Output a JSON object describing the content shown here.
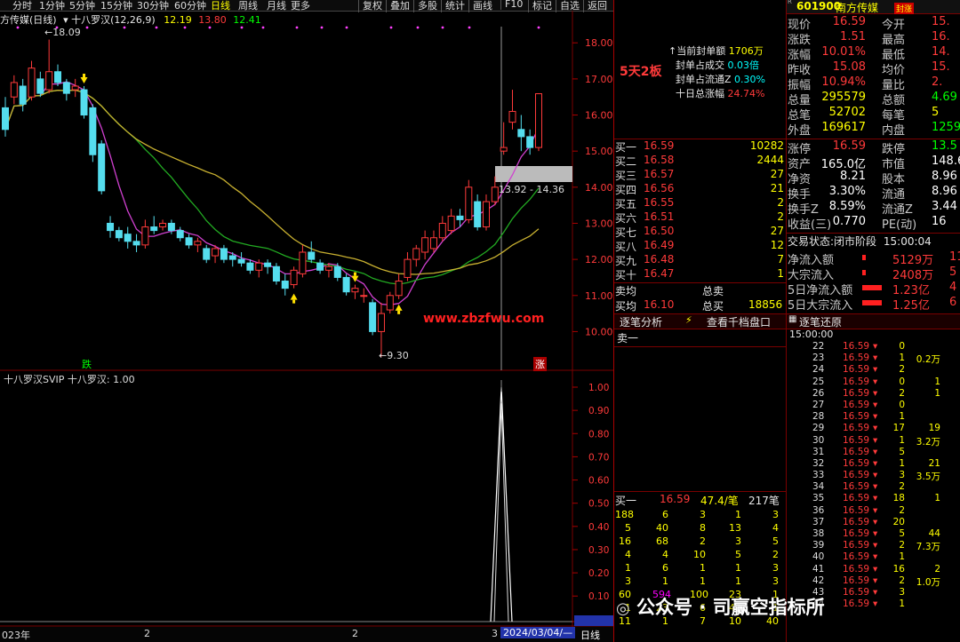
{
  "toolbar": {
    "periods": [
      "分时",
      "1分钟",
      "5分钟",
      "15分钟",
      "30分钟",
      "60分钟",
      "日线",
      "周线",
      "月线",
      "更多"
    ],
    "active_period": "日线",
    "tools": [
      "复权",
      "叠加",
      "多股",
      "统计",
      "画线",
      "F10",
      "标记",
      "自选",
      "返回"
    ]
  },
  "chart": {
    "title_left": "方传媒(日线)",
    "indicator_name": "十八罗汉(12,26,9)",
    "indicator_values": [
      "12.19",
      "13.80",
      "12.41"
    ],
    "high_label": "18.09",
    "low_label": "9.30",
    "range_label": "13.92 - 14.36",
    "y_ticks": [
      "18.00",
      "17.00",
      "16.00",
      "15.00",
      "14.00",
      "13.00",
      "12.00",
      "11.00",
      "10.00"
    ],
    "die_label": "跌",
    "zhang_label": "涨",
    "watermark": "www.zbzfwu.com",
    "lower_title": "十八罗汉SVIP  十八罗汉: 1.00",
    "lower_y_ticks": [
      "1.00",
      "0.90",
      "0.80",
      "0.70",
      "0.60",
      "0.50",
      "0.40",
      "0.30",
      "0.20",
      "0.10",
      "-0.01"
    ],
    "bottom_labels": [
      "023年",
      "2",
      "2",
      "3",
      "2024/03/04/—"
    ],
    "bottom_right": "日线",
    "candles": [
      {
        "o": 16.2,
        "c": 15.6,
        "h": 16.5,
        "l": 15.4
      },
      {
        "o": 16.5,
        "c": 16.9,
        "h": 17.1,
        "l": 16.3
      },
      {
        "o": 16.8,
        "c": 16.3,
        "h": 17.0,
        "l": 16.1
      },
      {
        "o": 16.5,
        "c": 17.3,
        "h": 17.5,
        "l": 16.4
      },
      {
        "o": 17.0,
        "c": 16.6,
        "h": 17.2,
        "l": 16.5
      },
      {
        "o": 16.7,
        "c": 17.2,
        "h": 18.09,
        "l": 16.6
      },
      {
        "o": 17.2,
        "c": 16.9,
        "h": 17.4,
        "l": 16.8
      },
      {
        "o": 16.9,
        "c": 16.6,
        "h": 17.0,
        "l": 16.4
      },
      {
        "o": 16.7,
        "c": 16.8,
        "h": 17.0,
        "l": 16.5
      },
      {
        "o": 16.7,
        "c": 16.0,
        "h": 16.8,
        "l": 15.9
      },
      {
        "o": 16.2,
        "c": 14.9,
        "h": 16.3,
        "l": 14.7
      },
      {
        "o": 15.2,
        "c": 13.9,
        "h": 15.3,
        "l": 13.8
      },
      {
        "o": 13.0,
        "c": 12.8,
        "h": 13.2,
        "l": 12.6
      },
      {
        "o": 12.8,
        "c": 12.6,
        "h": 12.9,
        "l": 12.5
      },
      {
        "o": 12.7,
        "c": 12.5,
        "h": 12.9,
        "l": 12.3
      },
      {
        "o": 12.5,
        "c": 12.4,
        "h": 12.7,
        "l": 12.2
      },
      {
        "o": 12.4,
        "c": 12.9,
        "h": 13.1,
        "l": 12.3
      },
      {
        "o": 12.9,
        "c": 12.8,
        "h": 13.2,
        "l": 12.7
      },
      {
        "o": 12.9,
        "c": 13.0,
        "h": 13.1,
        "l": 12.8
      },
      {
        "o": 13.0,
        "c": 12.8,
        "h": 13.1,
        "l": 12.7
      },
      {
        "o": 12.8,
        "c": 12.6,
        "h": 12.9,
        "l": 12.5
      },
      {
        "o": 12.6,
        "c": 12.4,
        "h": 12.7,
        "l": 12.3
      },
      {
        "o": 12.4,
        "c": 12.5,
        "h": 12.6,
        "l": 12.2
      },
      {
        "o": 12.3,
        "c": 12.0,
        "h": 12.4,
        "l": 11.9
      },
      {
        "o": 12.1,
        "c": 12.3,
        "h": 12.4,
        "l": 11.9
      },
      {
        "o": 12.3,
        "c": 12.0,
        "h": 12.4,
        "l": 11.9
      },
      {
        "o": 12.1,
        "c": 12.0,
        "h": 12.2,
        "l": 11.8
      },
      {
        "o": 12.0,
        "c": 11.9,
        "h": 12.2,
        "l": 11.8
      },
      {
        "o": 11.9,
        "c": 11.7,
        "h": 12.0,
        "l": 11.6
      },
      {
        "o": 11.7,
        "c": 11.9,
        "h": 12.0,
        "l": 11.5
      },
      {
        "o": 11.9,
        "c": 11.8,
        "h": 12.0,
        "l": 11.6
      },
      {
        "o": 11.8,
        "c": 11.4,
        "h": 11.9,
        "l": 11.3
      },
      {
        "o": 11.4,
        "c": 11.2,
        "h": 11.6,
        "l": 11.0
      },
      {
        "o": 11.3,
        "c": 11.7,
        "h": 11.8,
        "l": 11.2
      },
      {
        "o": 11.6,
        "c": 12.2,
        "h": 12.4,
        "l": 11.5
      },
      {
        "o": 12.2,
        "c": 12.0,
        "h": 12.5,
        "l": 11.9
      },
      {
        "o": 11.9,
        "c": 11.7,
        "h": 12.0,
        "l": 11.6
      },
      {
        "o": 11.7,
        "c": 11.8,
        "h": 11.9,
        "l": 11.5
      },
      {
        "o": 11.8,
        "c": 11.5,
        "h": 11.9,
        "l": 11.4
      },
      {
        "o": 11.5,
        "c": 11.1,
        "h": 11.6,
        "l": 11.0
      },
      {
        "o": 11.1,
        "c": 11.2,
        "h": 11.3,
        "l": 10.9
      },
      {
        "o": 11.0,
        "c": 11.0,
        "h": 11.2,
        "l": 10.8
      },
      {
        "o": 10.8,
        "c": 10.0,
        "h": 10.9,
        "l": 9.9
      },
      {
        "o": 10.0,
        "c": 10.5,
        "h": 10.8,
        "l": 9.3
      },
      {
        "o": 10.6,
        "c": 11.0,
        "h": 11.1,
        "l": 10.5
      },
      {
        "o": 11.0,
        "c": 11.4,
        "h": 11.6,
        "l": 10.9
      },
      {
        "o": 11.5,
        "c": 12.0,
        "h": 12.2,
        "l": 11.4
      },
      {
        "o": 12.0,
        "c": 12.3,
        "h": 12.4,
        "l": 11.8
      },
      {
        "o": 12.2,
        "c": 12.6,
        "h": 12.8,
        "l": 12.0
      },
      {
        "o": 12.3,
        "c": 12.6,
        "h": 12.8,
        "l": 12.2
      },
      {
        "o": 12.6,
        "c": 13.0,
        "h": 13.2,
        "l": 12.5
      },
      {
        "o": 12.8,
        "c": 13.2,
        "h": 13.4,
        "l": 12.7
      },
      {
        "o": 13.2,
        "c": 13.1,
        "h": 13.4,
        "l": 12.9
      },
      {
        "o": 13.1,
        "c": 14.0,
        "h": 14.2,
        "l": 13.0
      },
      {
        "o": 13.6,
        "c": 12.9,
        "h": 13.8,
        "l": 12.8
      },
      {
        "o": 12.9,
        "c": 13.6,
        "h": 13.8,
        "l": 12.8
      },
      {
        "o": 13.6,
        "c": 14.0,
        "h": 14.3,
        "l": 13.5
      },
      {
        "o": 15.0,
        "c": 15.1,
        "h": 15.8,
        "l": 14.9
      },
      {
        "o": 15.8,
        "c": 16.1,
        "h": 16.7,
        "l": 15.6
      },
      {
        "o": 15.6,
        "c": 15.4,
        "h": 16.0,
        "l": 15.0
      },
      {
        "o": 15.4,
        "c": 15.1,
        "h": 15.6,
        "l": 14.9
      },
      {
        "o": 15.1,
        "c": 16.59,
        "h": 16.6,
        "l": 15.0
      }
    ]
  },
  "info_box": {
    "board_tag": "5天2板",
    "rows": [
      {
        "label": "当前封单额",
        "value": "1706万"
      },
      {
        "label": "封单占成交",
        "value": "0.03倍"
      },
      {
        "label": "封单占流通Z",
        "value": "0.30%"
      },
      {
        "label": "十日总涨幅",
        "value": "24.74%"
      }
    ]
  },
  "stock": {
    "code": "601900",
    "name": "南方传媒",
    "tag": "封涨"
  },
  "quote": [
    {
      "l1": "现价",
      "v1": "16.59",
      "l2": "今开",
      "v2": "15."
    },
    {
      "l1": "涨跌",
      "v1": "1.51",
      "l2": "最高",
      "v2": "16."
    },
    {
      "l1": "涨幅",
      "v1": "10.01%",
      "l2": "最低",
      "v2": "14."
    },
    {
      "l1": "昨收",
      "v1": "15.08",
      "l2": "均价",
      "v2": "15."
    },
    {
      "l1": "振幅",
      "v1": "10.94%",
      "l2": "量比",
      "v2": "2."
    },
    {
      "l1": "总量",
      "v1": "295579",
      "l2": "总额",
      "v2": "4.69"
    },
    {
      "l1": "总笔",
      "v1": "52702",
      "l2": "每笔",
      "v2": "5"
    },
    {
      "l1": "外盘",
      "v1": "169617",
      "l2": "内盘",
      "v2": "1259"
    }
  ],
  "order_book": [
    {
      "label": "买一",
      "price": "16.59",
      "vol": "10282"
    },
    {
      "label": "买二",
      "price": "16.58",
      "vol": "2444"
    },
    {
      "label": "买三",
      "price": "16.57",
      "vol": "27"
    },
    {
      "label": "买四",
      "price": "16.56",
      "vol": "21"
    },
    {
      "label": "买五",
      "price": "16.55",
      "vol": "2"
    },
    {
      "label": "买六",
      "price": "16.51",
      "vol": "2"
    },
    {
      "label": "买七",
      "price": "16.50",
      "vol": "27"
    },
    {
      "label": "买八",
      "price": "16.49",
      "vol": "12"
    },
    {
      "label": "买九",
      "price": "16.48",
      "vol": "7"
    },
    {
      "label": "买十",
      "price": "16.47",
      "vol": "1"
    }
  ],
  "avg": {
    "sell_label": "卖均",
    "sell_total": "总卖",
    "buy_label": "买均",
    "buy_price": "16.10",
    "buy_total_label": "总买",
    "buy_total": "18856"
  },
  "stats": [
    {
      "l1": "涨停",
      "v1": "16.59",
      "l2": "跌停",
      "v2": "13.5"
    },
    {
      "l1": "资产",
      "v1": "165.0亿",
      "l2": "市值",
      "v2": "148.6"
    },
    {
      "l1": "净资",
      "v1": "8.21",
      "l2": "股本",
      "v2": "8.96"
    },
    {
      "l1": "换手",
      "v1": "3.30%",
      "l2": "流通",
      "v2": "8.96"
    },
    {
      "l1": "换手Z",
      "v1": "8.59%",
      "l2": "流通Z",
      "v2": "3.44"
    },
    {
      "l1": "收益(三)",
      "v1": "0.770",
      "l2": "PE(动)",
      "v2": "16"
    }
  ],
  "trade_status": {
    "label": "交易状态:",
    "status": "闭市阶段",
    "time": "15:00:04"
  },
  "flows": [
    {
      "label": "净流入额",
      "value": "5129万",
      "extra": "11"
    },
    {
      "label": "大宗流入",
      "value": "2408万",
      "extra": "5"
    },
    {
      "label": "5日净流入额",
      "value": "1.23亿",
      "extra": "4"
    },
    {
      "label": "5日大宗流入",
      "value": "1.25亿",
      "extra": "6"
    }
  ],
  "tabs": {
    "tick_analysis": "逐笔分析",
    "view_thousand": "查看千档盘口",
    "tick_restore": "逐笔还原"
  },
  "sell_one": "卖一",
  "buy_one_summary": {
    "label": "买一",
    "price": "16.59",
    "vol": "47.4/笔",
    "count": "217笔"
  },
  "queue": [
    [
      "188",
      "6",
      "3",
      "1",
      "3"
    ],
    [
      "5",
      "40",
      "8",
      "13",
      "4"
    ],
    [
      "16",
      "68",
      "2",
      "3",
      "5"
    ],
    [
      "4",
      "4",
      "10",
      "5",
      "2"
    ],
    [
      "1",
      "6",
      "1",
      "1",
      "3"
    ],
    [
      "3",
      "1",
      "1",
      "1",
      "3"
    ],
    [
      "60",
      "594",
      "100",
      "23",
      "1"
    ],
    [
      "1",
      "23",
      "6",
      "43",
      "1"
    ],
    [
      "11",
      "1",
      "7",
      "10",
      "40"
    ]
  ],
  "tick_restore": {
    "time": "15:00:00",
    "rows": [
      [
        "22",
        "16.59",
        "0",
        ""
      ],
      [
        "23",
        "16.59",
        "1",
        "0.2万"
      ],
      [
        "24",
        "16.59",
        "2",
        ""
      ],
      [
        "25",
        "16.59",
        "0",
        "1"
      ],
      [
        "26",
        "16.59",
        "2",
        "1"
      ],
      [
        "27",
        "16.59",
        "0",
        ""
      ],
      [
        "28",
        "16.59",
        "1",
        ""
      ],
      [
        "29",
        "16.59",
        "17",
        "19"
      ],
      [
        "30",
        "16.59",
        "1",
        "3.2万"
      ],
      [
        "31",
        "16.59",
        "5",
        ""
      ],
      [
        "32",
        "16.59",
        "1",
        "21"
      ],
      [
        "33",
        "16.59",
        "3",
        "3.5万"
      ],
      [
        "34",
        "16.59",
        "2",
        ""
      ],
      [
        "35",
        "16.59",
        "18",
        "1"
      ],
      [
        "36",
        "16.59",
        "2",
        ""
      ],
      [
        "37",
        "16.59",
        "20",
        ""
      ],
      [
        "38",
        "16.59",
        "5",
        "44"
      ],
      [
        "39",
        "16.59",
        "2",
        "7.3万"
      ],
      [
        "40",
        "16.59",
        "1",
        ""
      ],
      [
        "41",
        "16.59",
        "16",
        "2"
      ],
      [
        "42",
        "16.59",
        "2",
        "1.0万"
      ],
      [
        "43",
        "16.59",
        "3",
        ""
      ],
      [
        "44",
        "16.59",
        "1",
        ""
      ]
    ]
  },
  "footer_watermark": "公众号 · 司赢空指标所"
}
